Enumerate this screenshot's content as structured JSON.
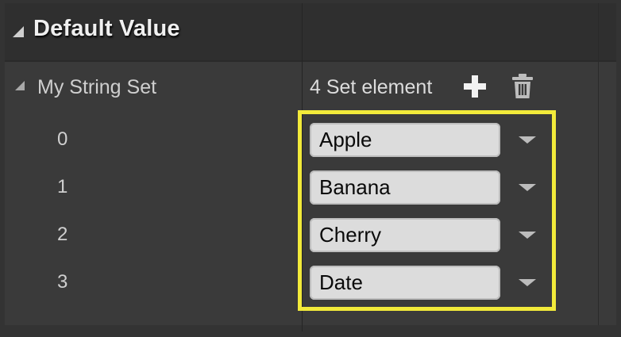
{
  "section": {
    "title": "Default Value"
  },
  "property": {
    "name": "My String Set",
    "count_label": "4 Set element"
  },
  "elements": [
    {
      "index": "0",
      "value": "Apple"
    },
    {
      "index": "1",
      "value": "Banana"
    },
    {
      "index": "2",
      "value": "Cherry"
    },
    {
      "index": "3",
      "value": "Date"
    }
  ],
  "colors": {
    "highlight": "#f2ea3a",
    "panel_background": "#3a3a3a",
    "header_background": "#2f2f2f",
    "field_background": "#dcdcdc"
  },
  "icons": {
    "section_expand": "triangle-expanded-icon",
    "property_expand": "triangle-expanded-icon",
    "add": "plus-icon",
    "delete": "trash-icon",
    "element_menu": "chevron-down-icon"
  }
}
